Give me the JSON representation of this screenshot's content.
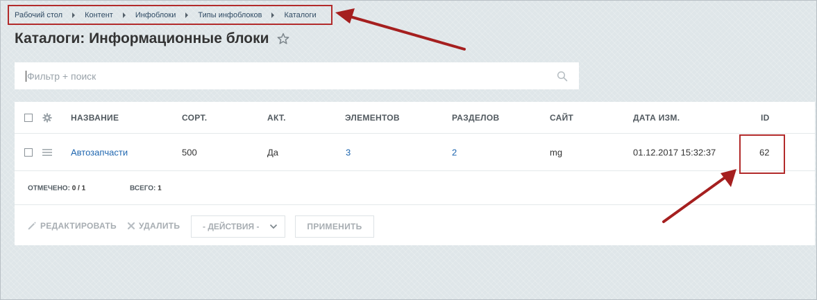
{
  "breadcrumb": [
    "Рабочий стол",
    "Контент",
    "Инфоблоки",
    "Типы инфоблоков",
    "Каталоги"
  ],
  "page": {
    "title": "Каталоги: Информационные блоки"
  },
  "filter": {
    "placeholder": "Фильтр + поиск"
  },
  "grid": {
    "columns": [
      "НАЗВАНИЕ",
      "СОРТ.",
      "АКТ.",
      "ЭЛЕМЕНТОВ",
      "РАЗДЕЛОВ",
      "САЙТ",
      "ДАТА ИЗМ.",
      "ID"
    ],
    "rows": [
      {
        "name": "Автозапчасти",
        "sort": "500",
        "active": "Да",
        "elements": "3",
        "sections": "2",
        "site": "mg",
        "modified": "01.12.2017 15:32:37",
        "id": "62"
      }
    ]
  },
  "footer": {
    "checked_label": "ОТМЕЧЕНО:",
    "checked_value": "0 / 1",
    "total_label": "ВСЕГО:",
    "total_value": "1"
  },
  "actions": {
    "edit": "РЕДАКТИРОВАТЬ",
    "delete": "УДАЛИТЬ",
    "select": "- ДЕЙСТВИЯ -",
    "apply": "ПРИМЕНИТЬ"
  },
  "colors": {
    "annotation": "#b22a2a",
    "link": "#2067b0",
    "background": "#dfe6e9"
  }
}
